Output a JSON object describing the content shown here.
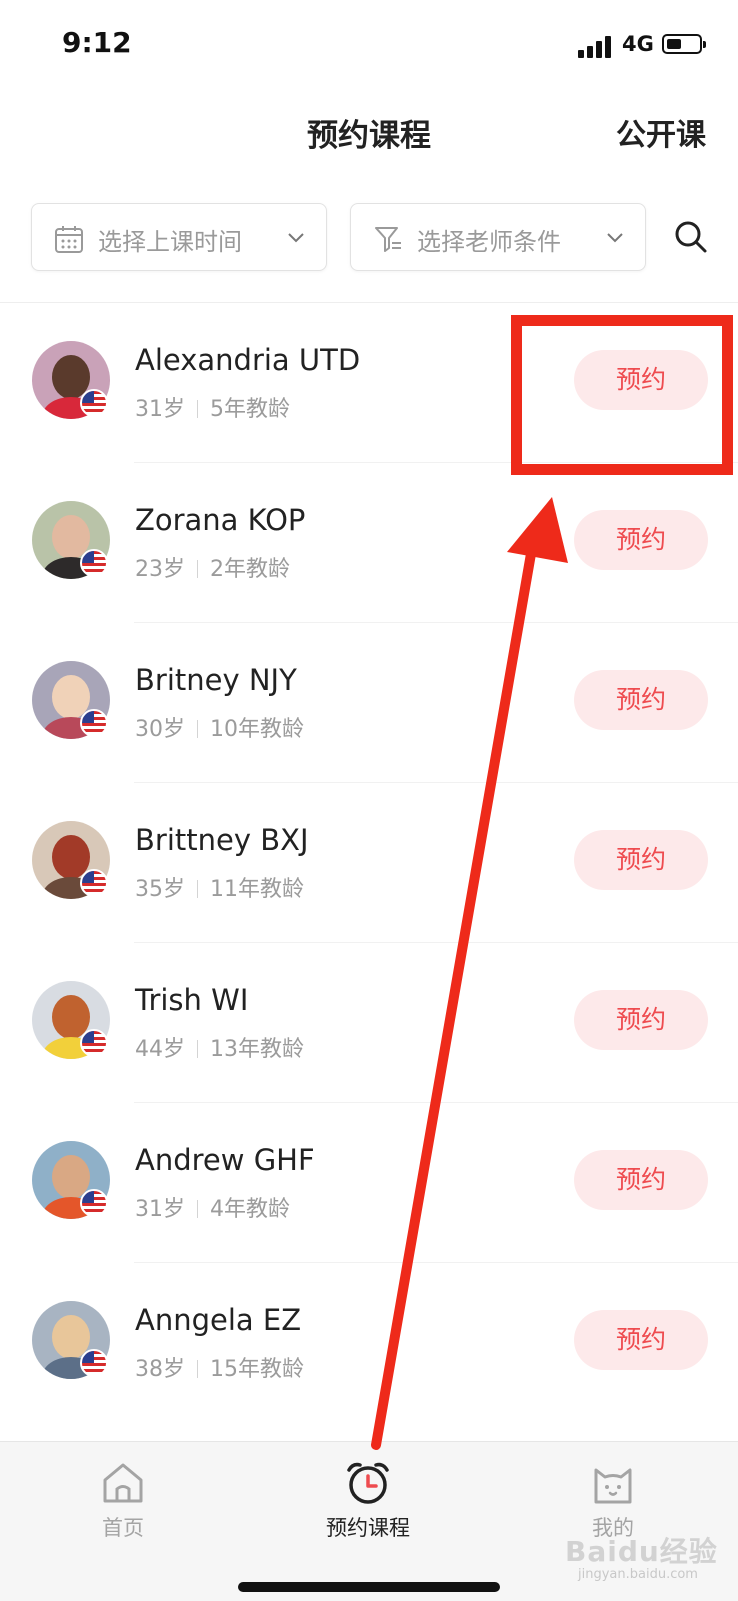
{
  "status_bar": {
    "time": "9:12",
    "network": "4G"
  },
  "header": {
    "title": "预约课程",
    "open_class": "公开课"
  },
  "filters": {
    "time": {
      "label": "选择上课时间",
      "icon": "calendar-icon"
    },
    "teacher": {
      "label": "选择老师条件",
      "icon": "filter-icon"
    }
  },
  "teachers": [
    {
      "name": "Alexandria UTD",
      "age": "31岁",
      "experience": "5年教龄",
      "button": "预约"
    },
    {
      "name": "Zorana KOP",
      "age": "23岁",
      "experience": "2年教龄",
      "button": "预约"
    },
    {
      "name": "Britney NJY",
      "age": "30岁",
      "experience": "10年教龄",
      "button": "预约"
    },
    {
      "name": "Brittney BXJ",
      "age": "35岁",
      "experience": "11年教龄",
      "button": "预约"
    },
    {
      "name": "Trish WI",
      "age": "44岁",
      "experience": "13年教龄",
      "button": "预约"
    },
    {
      "name": "Andrew GHF",
      "age": "31岁",
      "experience": "4年教龄",
      "button": "预约"
    },
    {
      "name": "Anngela EZ",
      "age": "38岁",
      "experience": "15年教龄",
      "button": "预约"
    }
  ],
  "tabs": [
    {
      "label": "首页",
      "icon": "home-icon",
      "active": false
    },
    {
      "label": "预约课程",
      "icon": "alarm-clock-icon",
      "active": true
    },
    {
      "label": "我的",
      "icon": "cat-face-icon",
      "active": false
    }
  ],
  "colors": {
    "accent": "#ee4b4f",
    "button_bg": "#fde9ea",
    "annotation": "#ee2a1a"
  },
  "watermark": {
    "brand": "Baidu经验",
    "url": "jingyan.baidu.com"
  }
}
